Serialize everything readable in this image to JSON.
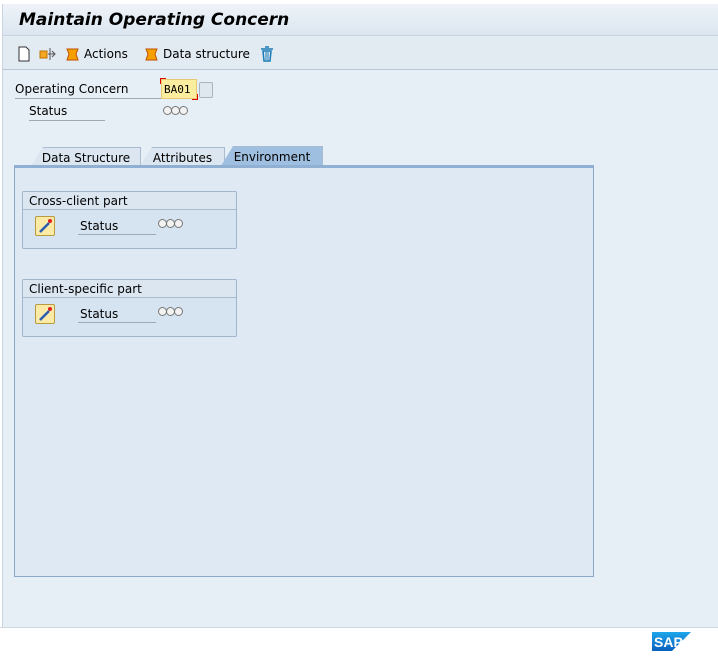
{
  "title": "Maintain Operating Concern",
  "toolbar": {
    "actions_label": "Actions",
    "data_structure_label": "Data structure"
  },
  "header": {
    "operating_concern_label": "Operating Concern",
    "operating_concern_value": "BA01",
    "status_label": "Status"
  },
  "tabs": [
    {
      "label": "Data Structure",
      "active": false
    },
    {
      "label": "Attributes",
      "active": false
    },
    {
      "label": "Environment",
      "active": true
    }
  ],
  "groups": [
    {
      "title": "Cross-client part",
      "status_label": "Status"
    },
    {
      "title": "Client-specific part",
      "status_label": "Status"
    }
  ],
  "icons": [
    "new-document-icon",
    "transport-icon",
    "actions-icon",
    "data-structure-icon",
    "delete-icon",
    "edit-icon",
    "f4-help-icon",
    "status-lights-icon",
    "sap-logo"
  ],
  "colors": {
    "background": "#e6eef6",
    "active_tab": "#9fbfe0",
    "input_highlight": "#fbee9f",
    "brand": "#0a66c2"
  },
  "logo_text": "SAP"
}
